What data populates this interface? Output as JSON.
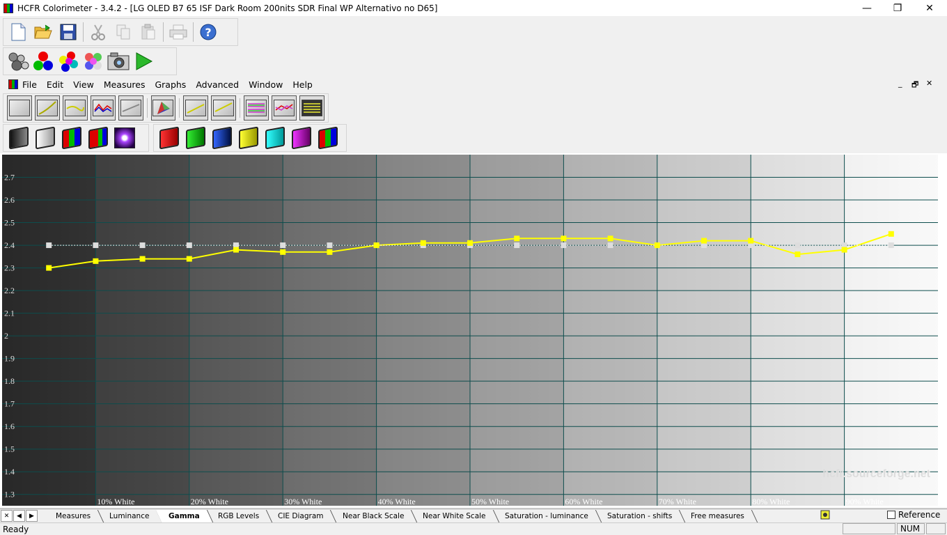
{
  "window": {
    "title": "HCFR Colorimeter - 3.4.2 - [LG OLED B7 65 ISF Dark Room 200nits SDR Final WP Alternativo no D65]",
    "controls": {
      "minimize": "—",
      "restore": "❐",
      "close": "✕"
    }
  },
  "menu": {
    "items": [
      {
        "label": "File"
      },
      {
        "label": "Edit"
      },
      {
        "label": "View"
      },
      {
        "label": "Measures"
      },
      {
        "label": "Graphs"
      },
      {
        "label": "Advanced"
      },
      {
        "label": "Window"
      },
      {
        "label": "Help"
      }
    ],
    "mdi": {
      "minimize": "_",
      "restore": "🗗",
      "close": "✕"
    }
  },
  "toolbar1": {
    "icons": [
      "new-icon",
      "open-icon",
      "save-icon",
      "cut-icon",
      "copy-icon",
      "paste-icon",
      "print-icon",
      "help-icon"
    ]
  },
  "toolbar2": {
    "icons": [
      "probe-icon",
      "rgb-balls-icon",
      "color-balls-icon",
      "multi-balls-icon",
      "camera-icon",
      "play-icon"
    ]
  },
  "graph_toolbar": {
    "icons": [
      "luminance-graph-icon",
      "gamma-graph-icon",
      "rgb-levels-graph-icon",
      "rgb-curves-graph-icon",
      "gray-graph-icon",
      "cie-diagram-icon",
      "near-black-graph-icon",
      "near-white-graph-icon",
      "saturation-luminance-icon",
      "saturation-shifts-icon",
      "free-measures-icon"
    ]
  },
  "film_toolbar": {
    "icons": [
      "gray-film-icon",
      "gray-film-2-icon",
      "rgb-film-icon",
      "rgb-film-2-icon",
      "contrast-icon",
      "red-film-icon",
      "green-film-icon",
      "blue-film-icon",
      "yellow-film-icon",
      "cyan-film-icon",
      "magenta-film-icon",
      "all-colors-film-icon"
    ]
  },
  "chart_data": {
    "type": "line",
    "ylim": [
      1.25,
      2.8
    ],
    "yticks": [
      "2.7",
      "2.6",
      "2.5",
      "2.4",
      "2.3",
      "2.2",
      "2.1",
      "2",
      "1.9",
      "1.8",
      "1.7",
      "1.6",
      "1.5",
      "1.4",
      "1.3"
    ],
    "ytick_values": [
      2.7,
      2.6,
      2.5,
      2.4,
      2.3,
      2.2,
      2.1,
      2.0,
      1.9,
      1.8,
      1.7,
      1.6,
      1.5,
      1.4,
      1.3
    ],
    "xticks": [
      "10% White",
      "20% White",
      "30% White",
      "40% White",
      "50% White",
      "60% White",
      "70% White",
      "80% White",
      "90% White"
    ],
    "xtick_values": [
      10,
      20,
      30,
      40,
      50,
      60,
      70,
      80,
      90
    ],
    "xlim": [
      0,
      100
    ],
    "x": [
      5,
      10,
      15,
      20,
      25,
      30,
      35,
      40,
      45,
      50,
      55,
      60,
      65,
      70,
      75,
      80,
      85,
      90,
      95
    ],
    "series": [
      {
        "values": [
          2.3,
          2.33,
          2.34,
          2.34,
          2.38,
          2.37,
          2.37,
          2.4,
          2.41,
          2.41,
          2.43,
          2.43,
          2.43,
          2.4,
          2.42,
          2.42,
          2.36,
          2.38,
          2.45
        ],
        "color": "#ffff00"
      },
      {
        "values": [
          2.4,
          2.4,
          2.4,
          2.4,
          2.4,
          2.4,
          2.4,
          2.4,
          2.4,
          2.4,
          2.4,
          2.4,
          2.4,
          2.4,
          2.4,
          2.4,
          2.4,
          2.4,
          2.4
        ],
        "color": "#ffffff",
        "style": "dotted"
      }
    ],
    "watermark": "hcfr.sourceforge.net",
    "grid": true
  },
  "tabs": [
    {
      "label": "Measures"
    },
    {
      "label": "Luminance"
    },
    {
      "label": "Gamma",
      "active": true
    },
    {
      "label": "RGB Levels"
    },
    {
      "label": "CIE Diagram"
    },
    {
      "label": "Near Black Scale"
    },
    {
      "label": "Near White Scale"
    },
    {
      "label": "Saturation - luminance"
    },
    {
      "label": "Saturation - shifts"
    },
    {
      "label": "Free measures"
    }
  ],
  "reference": {
    "label": "Reference",
    "checked": false
  },
  "status": {
    "text": "Ready",
    "num": "NUM"
  }
}
